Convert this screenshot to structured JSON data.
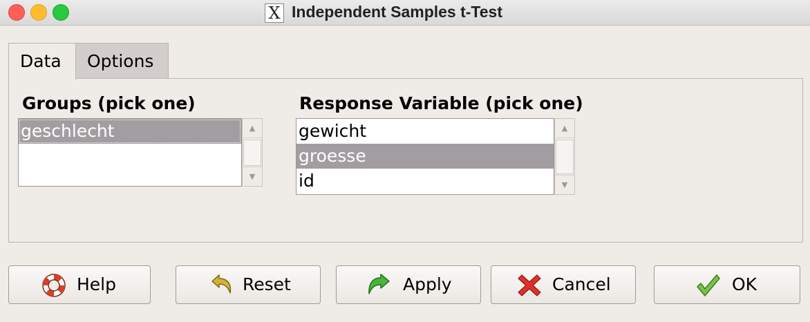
{
  "window": {
    "title": "Independent Samples t-Test",
    "app_icon": "x11-icon",
    "app_icon_glyph": "X"
  },
  "tabs": [
    {
      "label": "Data",
      "active": true
    },
    {
      "label": "Options",
      "active": false
    }
  ],
  "groups": {
    "label": "Groups (pick one)",
    "items": [
      "geschlecht"
    ],
    "selected": "geschlecht"
  },
  "response": {
    "label": "Response Variable (pick one)",
    "items": [
      "gewicht",
      "groesse",
      "id"
    ],
    "selected": "groesse"
  },
  "buttons": {
    "help": {
      "label": "Help",
      "icon": "lifebuoy-icon"
    },
    "reset": {
      "label": "Reset",
      "icon": "undo-arrow-icon"
    },
    "apply": {
      "label": "Apply",
      "icon": "green-arrow-icon"
    },
    "cancel": {
      "label": "Cancel",
      "icon": "red-x-icon"
    },
    "ok": {
      "label": "OK",
      "icon": "checkmark-icon"
    }
  },
  "colors": {
    "selection": "#a19da0",
    "window_bg": "#efebe7"
  }
}
